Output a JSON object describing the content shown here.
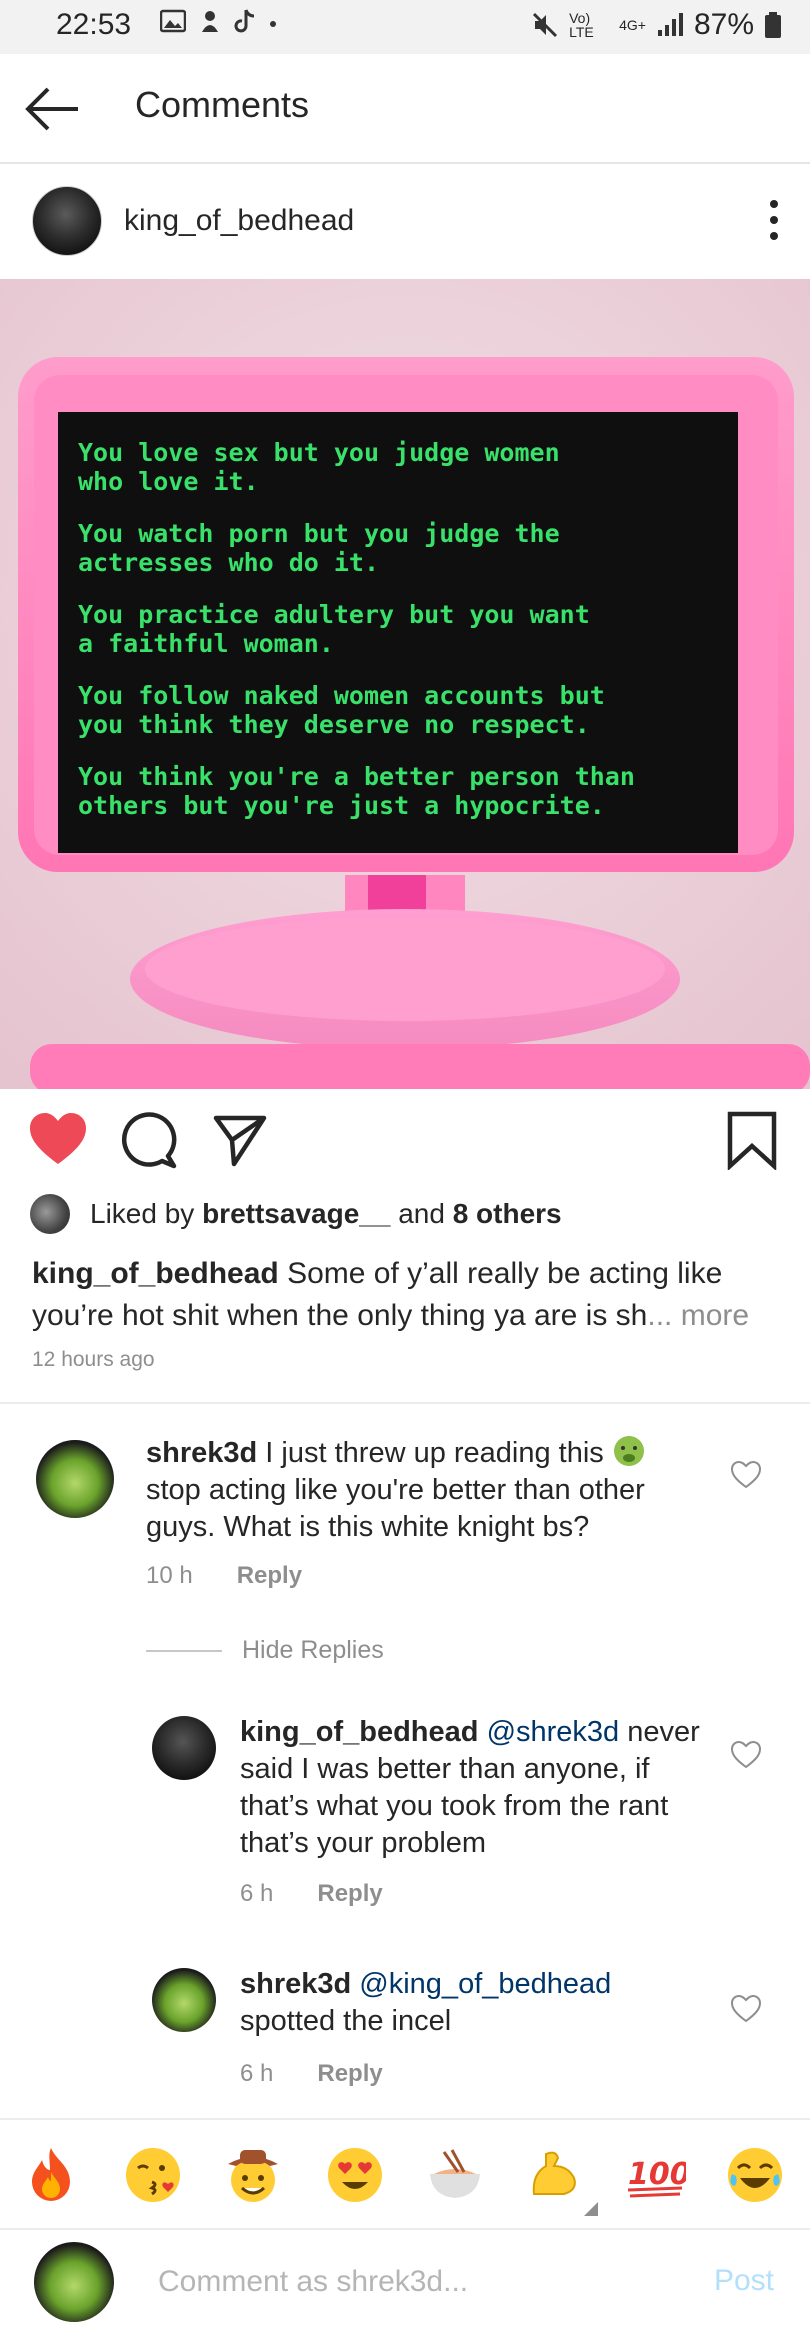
{
  "status": {
    "time": "22:53",
    "battery": "87%",
    "net_top": "Vo) LTE",
    "net_4g": "4G+"
  },
  "header": {
    "title": "Comments"
  },
  "post": {
    "username": "king_of_bedhead",
    "image_lines": [
      "You love sex but you judge women",
      "who love it.",
      "You watch porn but you judge the",
      "actresses who do it.",
      "You practice adultery but you want",
      "a faithful woman.",
      "You follow naked women accounts but",
      "you think they deserve no respect.",
      "You think you're a better person than",
      "others but you're just a hypocrite."
    ],
    "likes_prefix": "Liked by",
    "liked_by": "brettsavage__",
    "likes_and": "and",
    "likes_others": "8 others",
    "caption_user": "king_of_bedhead",
    "caption_text": "Some of y’all really be acting like you’re hot shit when the only thing ya are is sh",
    "caption_more": "... more",
    "time_ago": "12 hours ago"
  },
  "comments": {
    "c1": {
      "user": "shrek3d",
      "text": "I just threw up reading this",
      "text2": "stop acting like you're better than other guys. What is this white knight bs?",
      "time": "10 h",
      "reply": "Reply"
    },
    "hide_replies": "Hide Replies",
    "r1": {
      "user": "king_of_bedhead",
      "mention": "@shrek3d",
      "text": "never said I was better than anyone, if that’s what you took from the rant that’s your problem",
      "time": "6 h",
      "reply": "Reply"
    },
    "r2": {
      "user": "shrek3d",
      "mention": "@king_of_bedhead",
      "text": "spotted the incel",
      "time": "6 h",
      "reply": "Reply"
    }
  },
  "emoji_bar": [
    "fire",
    "kissing-face",
    "cowboy-face",
    "heart-eyes",
    "ramen-bowl",
    "flexed-biceps",
    "hundred-points",
    "tears-of-joy"
  ],
  "hundred_text": "100",
  "input": {
    "placeholder": "Comment as shrek3d...",
    "post_label": "Post"
  },
  "colors": {
    "like_red": "#ed4956",
    "mention_blue": "#003569",
    "post_blue": "#b2dffc",
    "screen_green": "#39e06a",
    "monitor_pink": "#ff80b8"
  }
}
